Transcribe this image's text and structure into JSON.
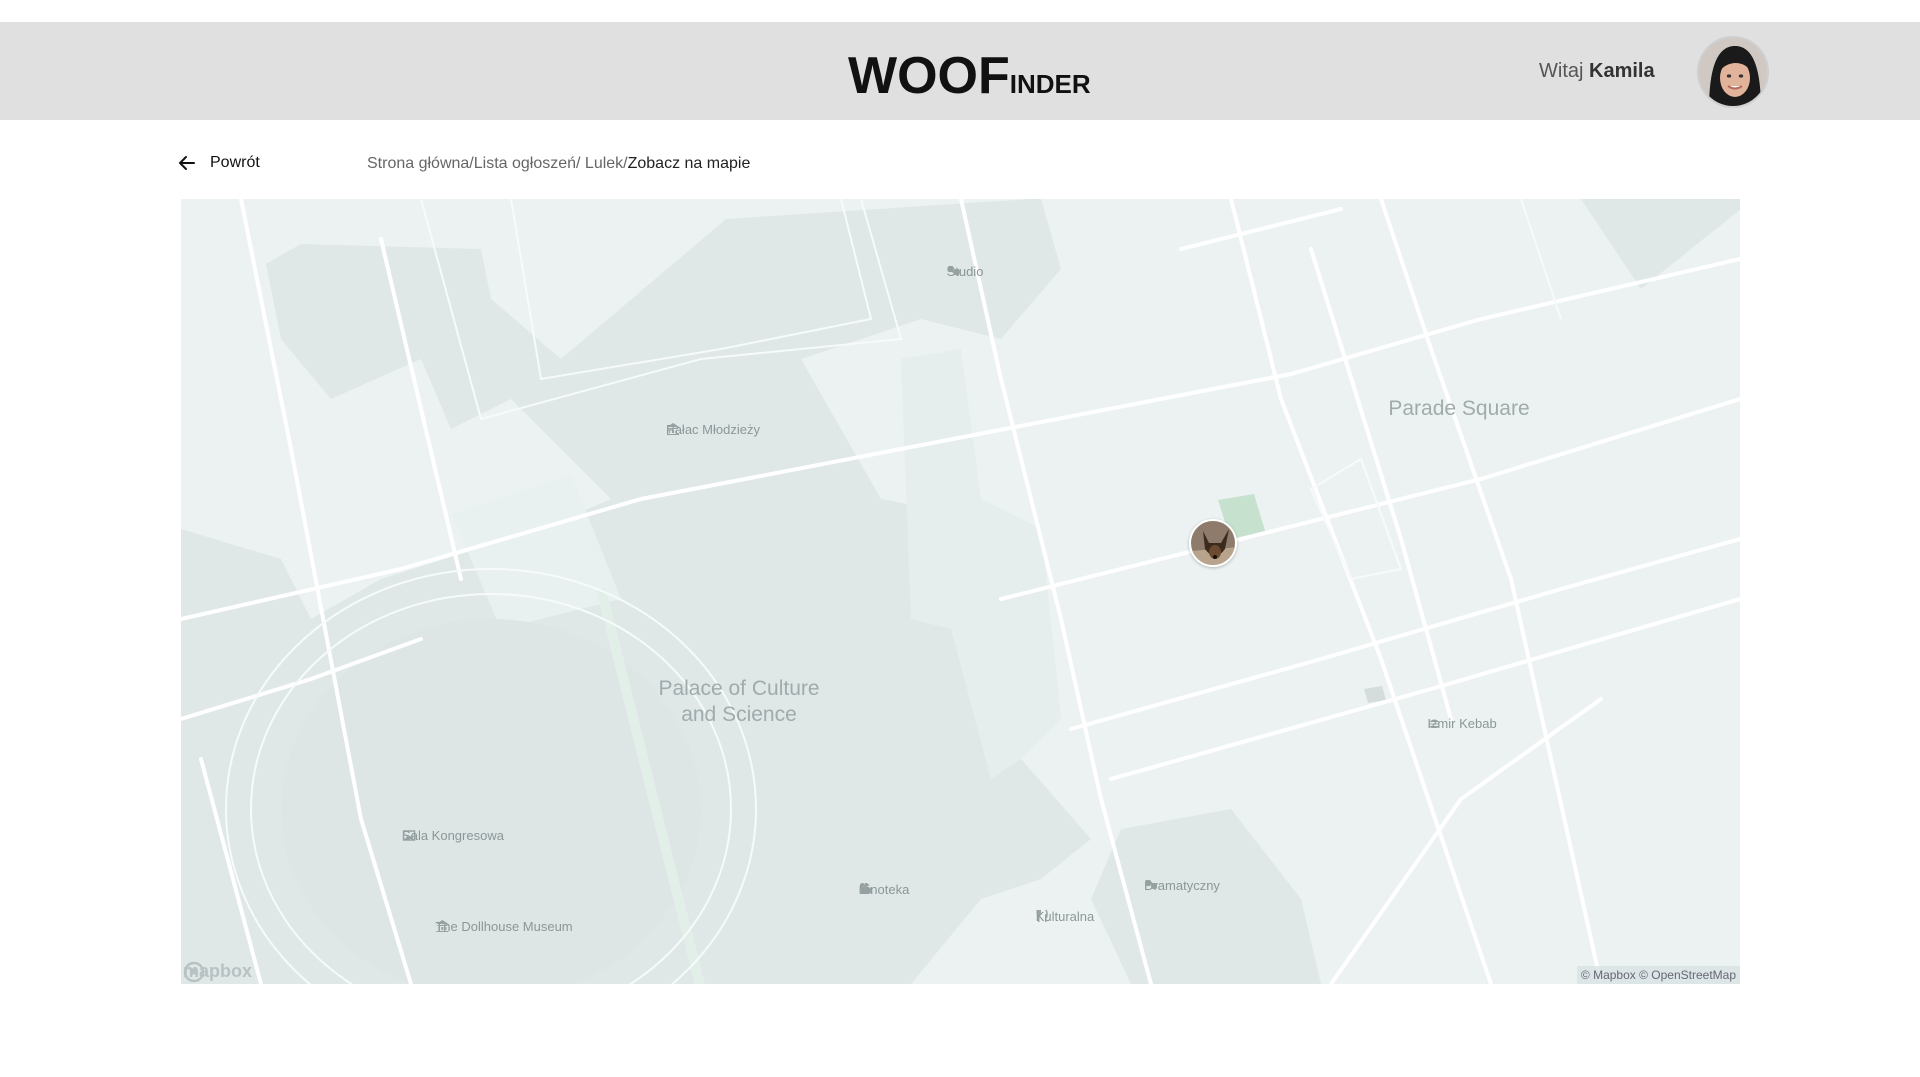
{
  "header": {
    "logo_big": "WOOF",
    "logo_small": "INDER",
    "greeting_prefix": "Witaj",
    "user_name": "Kamila"
  },
  "nav": {
    "back_label": "Powrót",
    "breadcrumb_path": "Strona główna/Lista ogłoszeń/ Lulek/",
    "breadcrumb_current": "Zobacz na mapie"
  },
  "map": {
    "area_labels": {
      "parade_square": "Parade Square",
      "palace_line1": "Palace of Culture",
      "palace_line2": "and Science"
    },
    "pois": {
      "studio": "Studio",
      "palac_mlodziezy": "Pałac Młodzieży",
      "sala_kongresowa": "Sala Kongresowa",
      "dollhouse_museum": "The Dollhouse Museum",
      "kinoteka": "Kinoteka",
      "kulturalna": "Kulturalna",
      "dramatyczny": "Dramatyczny",
      "izmir_kebab": "Izmir Kebab"
    },
    "mapbox_logo": "mapbox",
    "attribution": "© Mapbox © OpenStreetMap",
    "icons": {
      "studio": "theater-icon",
      "palac_mlodziezy": "museum-icon",
      "sala_kongresowa": "gallery-icon",
      "dollhouse_museum": "museum-icon",
      "kinoteka": "cinema-icon",
      "kulturalna": "restaurant-icon",
      "dramatyczny": "theater-icon",
      "izmir_kebab": "fast-food-icon"
    }
  },
  "colors": {
    "header_bg": "#e0e0e0",
    "map_bg": "#ecf2f2",
    "building": "#dfe7e7",
    "park": "#c6e2cf",
    "road": "#ffffff"
  }
}
